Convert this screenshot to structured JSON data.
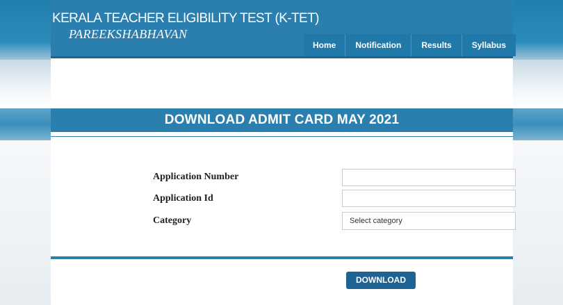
{
  "header": {
    "title": "KERALA TEACHER ELIGIBILITY TEST (K-TET)",
    "subtitle": "PAREEKSHABHAVAN"
  },
  "nav": {
    "items": [
      {
        "label": "Home"
      },
      {
        "label": "Notification"
      },
      {
        "label": "Results"
      },
      {
        "label": "Syllabus"
      }
    ]
  },
  "main": {
    "heading": "DOWNLOAD ADMIT CARD MAY 2021"
  },
  "form": {
    "application_number": {
      "label": "Application Number",
      "value": ""
    },
    "application_id": {
      "label": "Application Id",
      "value": ""
    },
    "category": {
      "label": "Category",
      "selected": "Select category"
    },
    "download_label": "DOWNLOAD"
  },
  "colors": {
    "primary": "#2a7fae",
    "button": "#1f6394"
  }
}
